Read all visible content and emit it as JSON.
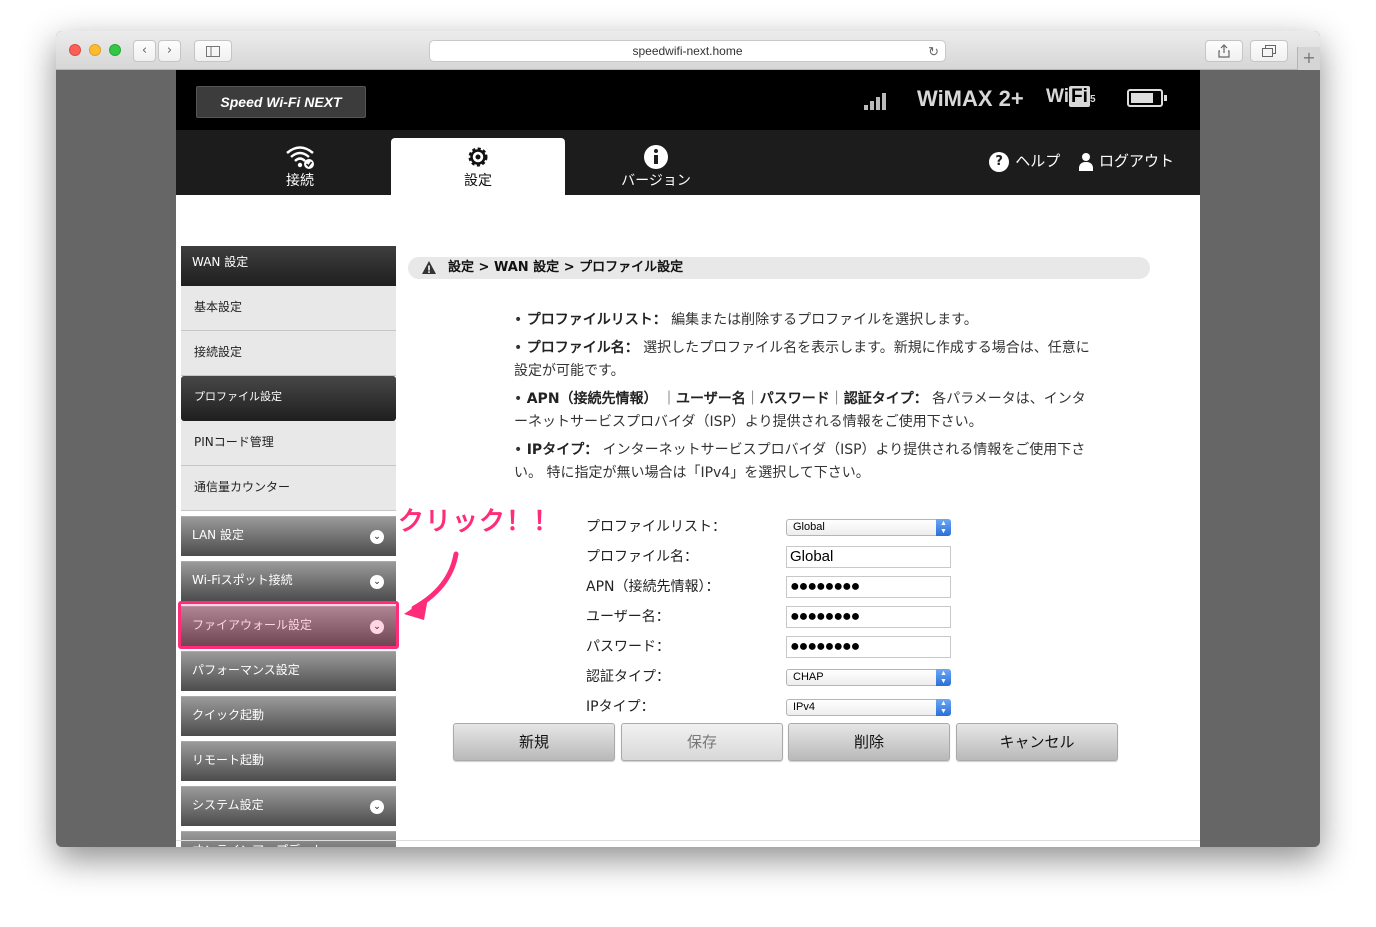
{
  "browser": {
    "url": "speedwifi-next.home",
    "reload_icon": "reload-icon",
    "new_tab": "+"
  },
  "header": {
    "logo": "Speed Wi-Fi NEXT",
    "network": "WiMAX 2+",
    "wifi_a": "Wi",
    "wifi_b": "Fi",
    "wifi_c": "5",
    "battery_level": 0.8,
    "signal_bars": 4
  },
  "nav": {
    "tabs": [
      {
        "label": "接続",
        "icon": "wifi-icon"
      },
      {
        "label": "設定",
        "icon": "gear-icon"
      },
      {
        "label": "バージョン",
        "icon": "info-icon"
      }
    ],
    "active_tab": "設定",
    "help": "ヘルプ",
    "logout": "ログアウト"
  },
  "sidebar": {
    "section": "WAN 設定",
    "sub_items": [
      "基本設定",
      "接続設定",
      "プロファイル設定",
      "PINコード管理",
      "通信量カウンター"
    ],
    "selected": "プロファイル設定",
    "items": [
      "LAN 設定",
      "Wi-Fiスポット接続",
      "ファイアウォール設定",
      "パフォーマンス設定",
      "クイック起動",
      "リモート起動",
      "システム設定",
      "オンラインアップデート"
    ]
  },
  "annotation": {
    "text": "クリック！！",
    "highlight_color": "#ff2c7a"
  },
  "breadcrumb": "設定 > WAN 設定 > プロファイル設定",
  "help": {
    "p1_label": "プロファイルリスト：",
    "p1_text": "編集または削除するプロファイルを選択します。",
    "p2_label": "プロファイル名：",
    "p2_text": "選択したプロファイル名を表示します。新規に作成する場合は、任意に設定が可能です。",
    "p3_a": "APN（接続先情報）",
    "p3_b": "ユーザー名",
    "p3_c": "パスワード",
    "p3_d": "認証タイプ：",
    "p3_sep": "｜",
    "p3_text": "各パラメータは、インターネットサービスプロバイダ（ISP）より提供される情報をご使用下さい。",
    "p4_label": "IPタイプ：",
    "p4_text": "インターネットサービスプロバイダ（ISP）より提供される情報をご使用下さい。 特に指定が無い場合は「IPv4」を選択して下さい。"
  },
  "form": {
    "profile_list_label": "プロファイルリスト：",
    "profile_list_value": "Global",
    "profile_name_label": "プロファイル名：",
    "profile_name_value": "Global",
    "apn_label": "APN（接続先情報）：",
    "apn_value": "●●●●●●●●",
    "user_label": "ユーザー名：",
    "user_value": "●●●●●●●●",
    "password_label": "パスワード：",
    "password_value": "●●●●●●●●",
    "auth_label": "認証タイプ：",
    "auth_value": "CHAP",
    "ip_label": "IPタイプ：",
    "ip_value": "IPv4"
  },
  "buttons": {
    "new": "新規",
    "save": "保存",
    "delete": "削除",
    "cancel": "キャンセル"
  },
  "colors": {
    "highlight": "#ff2c7a",
    "header_bg": "#000000",
    "nav_bg": "#1c1c1c"
  }
}
